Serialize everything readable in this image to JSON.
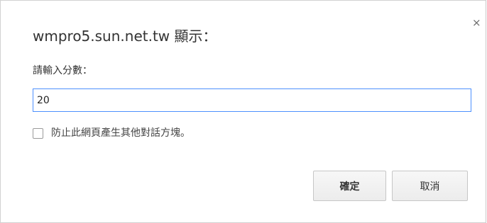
{
  "dialog": {
    "title": "wmpro5.sun.net.tw 顯示：",
    "prompt": "請輸入分數：",
    "input_value": "20",
    "checkbox_label": "防止此網頁產生其他對話方塊。",
    "checkbox_checked": false,
    "ok_label": "確定",
    "cancel_label": "取消",
    "close_glyph": "×"
  },
  "colors": {
    "input_focus_border": "#4d90fe",
    "button_border": "#c6c6c6",
    "text": "#333333"
  },
  "icons": {
    "close": "close-icon"
  }
}
